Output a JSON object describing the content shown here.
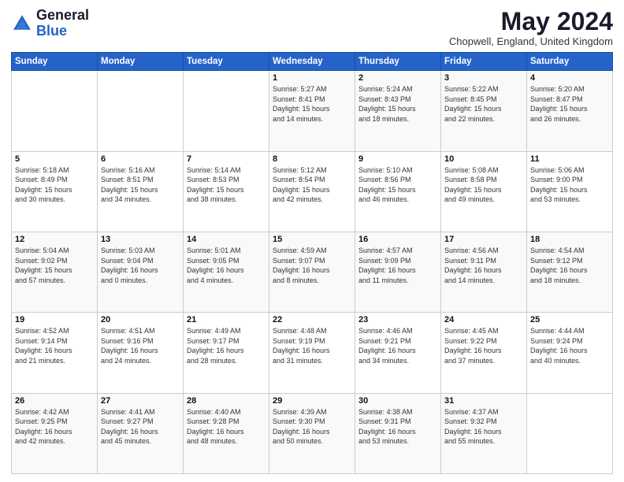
{
  "header": {
    "logo": {
      "general": "General",
      "blue": "Blue"
    },
    "title": "May 2024",
    "location": "Chopwell, England, United Kingdom"
  },
  "days_of_week": [
    "Sunday",
    "Monday",
    "Tuesday",
    "Wednesday",
    "Thursday",
    "Friday",
    "Saturday"
  ],
  "weeks": [
    [
      {
        "day": "",
        "info": ""
      },
      {
        "day": "",
        "info": ""
      },
      {
        "day": "",
        "info": ""
      },
      {
        "day": "1",
        "info": "Sunrise: 5:27 AM\nSunset: 8:41 PM\nDaylight: 15 hours\nand 14 minutes."
      },
      {
        "day": "2",
        "info": "Sunrise: 5:24 AM\nSunset: 8:43 PM\nDaylight: 15 hours\nand 18 minutes."
      },
      {
        "day": "3",
        "info": "Sunrise: 5:22 AM\nSunset: 8:45 PM\nDaylight: 15 hours\nand 22 minutes."
      },
      {
        "day": "4",
        "info": "Sunrise: 5:20 AM\nSunset: 8:47 PM\nDaylight: 15 hours\nand 26 minutes."
      }
    ],
    [
      {
        "day": "5",
        "info": "Sunrise: 5:18 AM\nSunset: 8:49 PM\nDaylight: 15 hours\nand 30 minutes."
      },
      {
        "day": "6",
        "info": "Sunrise: 5:16 AM\nSunset: 8:51 PM\nDaylight: 15 hours\nand 34 minutes."
      },
      {
        "day": "7",
        "info": "Sunrise: 5:14 AM\nSunset: 8:53 PM\nDaylight: 15 hours\nand 38 minutes."
      },
      {
        "day": "8",
        "info": "Sunrise: 5:12 AM\nSunset: 8:54 PM\nDaylight: 15 hours\nand 42 minutes."
      },
      {
        "day": "9",
        "info": "Sunrise: 5:10 AM\nSunset: 8:56 PM\nDaylight: 15 hours\nand 46 minutes."
      },
      {
        "day": "10",
        "info": "Sunrise: 5:08 AM\nSunset: 8:58 PM\nDaylight: 15 hours\nand 49 minutes."
      },
      {
        "day": "11",
        "info": "Sunrise: 5:06 AM\nSunset: 9:00 PM\nDaylight: 15 hours\nand 53 minutes."
      }
    ],
    [
      {
        "day": "12",
        "info": "Sunrise: 5:04 AM\nSunset: 9:02 PM\nDaylight: 15 hours\nand 57 minutes."
      },
      {
        "day": "13",
        "info": "Sunrise: 5:03 AM\nSunset: 9:04 PM\nDaylight: 16 hours\nand 0 minutes."
      },
      {
        "day": "14",
        "info": "Sunrise: 5:01 AM\nSunset: 9:05 PM\nDaylight: 16 hours\nand 4 minutes."
      },
      {
        "day": "15",
        "info": "Sunrise: 4:59 AM\nSunset: 9:07 PM\nDaylight: 16 hours\nand 8 minutes."
      },
      {
        "day": "16",
        "info": "Sunrise: 4:57 AM\nSunset: 9:09 PM\nDaylight: 16 hours\nand 11 minutes."
      },
      {
        "day": "17",
        "info": "Sunrise: 4:56 AM\nSunset: 9:11 PM\nDaylight: 16 hours\nand 14 minutes."
      },
      {
        "day": "18",
        "info": "Sunrise: 4:54 AM\nSunset: 9:12 PM\nDaylight: 16 hours\nand 18 minutes."
      }
    ],
    [
      {
        "day": "19",
        "info": "Sunrise: 4:52 AM\nSunset: 9:14 PM\nDaylight: 16 hours\nand 21 minutes."
      },
      {
        "day": "20",
        "info": "Sunrise: 4:51 AM\nSunset: 9:16 PM\nDaylight: 16 hours\nand 24 minutes."
      },
      {
        "day": "21",
        "info": "Sunrise: 4:49 AM\nSunset: 9:17 PM\nDaylight: 16 hours\nand 28 minutes."
      },
      {
        "day": "22",
        "info": "Sunrise: 4:48 AM\nSunset: 9:19 PM\nDaylight: 16 hours\nand 31 minutes."
      },
      {
        "day": "23",
        "info": "Sunrise: 4:46 AM\nSunset: 9:21 PM\nDaylight: 16 hours\nand 34 minutes."
      },
      {
        "day": "24",
        "info": "Sunrise: 4:45 AM\nSunset: 9:22 PM\nDaylight: 16 hours\nand 37 minutes."
      },
      {
        "day": "25",
        "info": "Sunrise: 4:44 AM\nSunset: 9:24 PM\nDaylight: 16 hours\nand 40 minutes."
      }
    ],
    [
      {
        "day": "26",
        "info": "Sunrise: 4:42 AM\nSunset: 9:25 PM\nDaylight: 16 hours\nand 42 minutes."
      },
      {
        "day": "27",
        "info": "Sunrise: 4:41 AM\nSunset: 9:27 PM\nDaylight: 16 hours\nand 45 minutes."
      },
      {
        "day": "28",
        "info": "Sunrise: 4:40 AM\nSunset: 9:28 PM\nDaylight: 16 hours\nand 48 minutes."
      },
      {
        "day": "29",
        "info": "Sunrise: 4:39 AM\nSunset: 9:30 PM\nDaylight: 16 hours\nand 50 minutes."
      },
      {
        "day": "30",
        "info": "Sunrise: 4:38 AM\nSunset: 9:31 PM\nDaylight: 16 hours\nand 53 minutes."
      },
      {
        "day": "31",
        "info": "Sunrise: 4:37 AM\nSunset: 9:32 PM\nDaylight: 16 hours\nand 55 minutes."
      },
      {
        "day": "",
        "info": ""
      }
    ]
  ],
  "colors": {
    "header_bg": "#2563c9",
    "accent": "#2563c9"
  }
}
